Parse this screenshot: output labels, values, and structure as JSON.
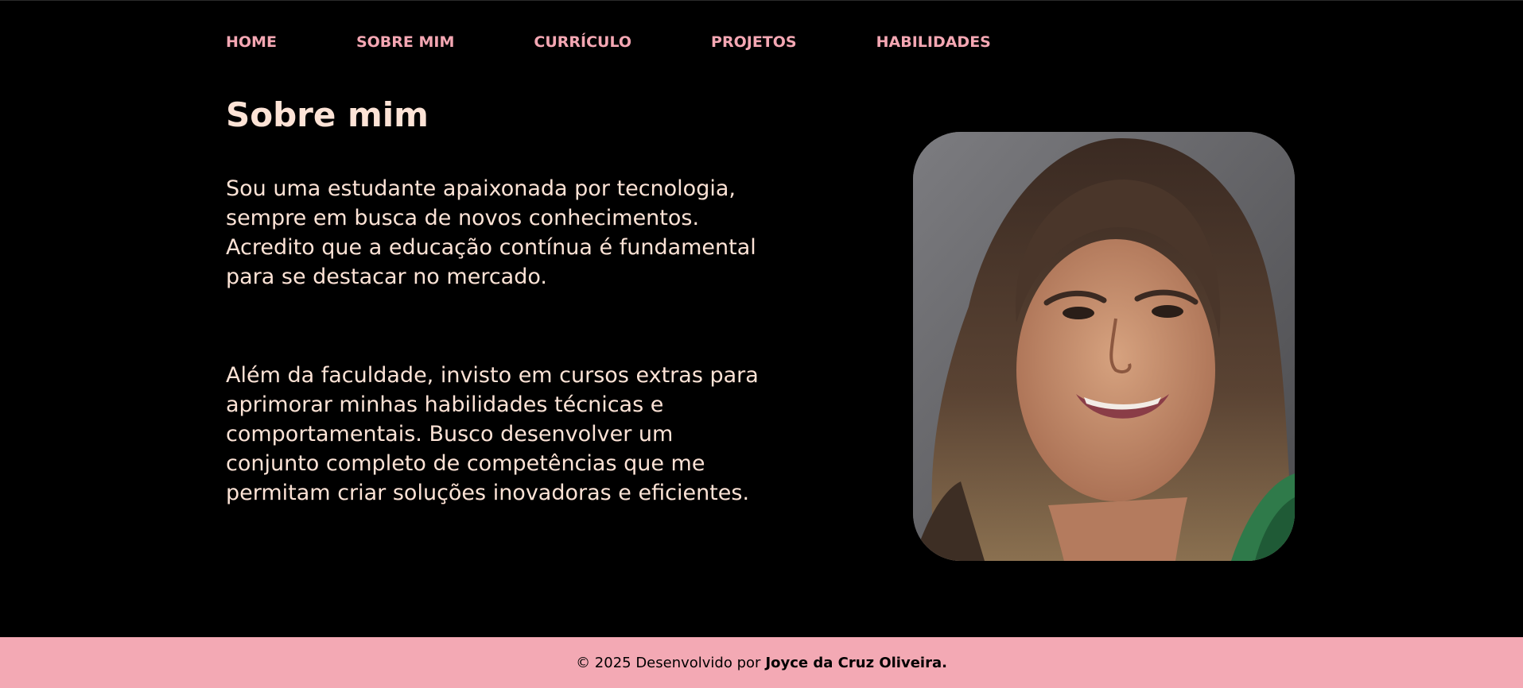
{
  "nav": {
    "items": [
      {
        "label": "HOME"
      },
      {
        "label": "SOBRE MIM"
      },
      {
        "label": "CURRÍCULO"
      },
      {
        "label": "PROJETOS"
      },
      {
        "label": "HABILIDADES"
      }
    ]
  },
  "about": {
    "title": "Sobre mim",
    "paragraph1": "Sou uma estudante apaixonada por tecnologia, sempre em busca de novos conhecimentos. Acredito que a educação contínua é fundamental para se destacar no mercado.",
    "paragraph2": "Além da faculdade, invisto em cursos extras para aprimorar minhas habilidades técnicas e comportamentais. Busco desenvolver um conjunto completo de competências que me permitam criar soluções inovadoras e eficientes."
  },
  "footer": {
    "text": "© 2025 Desenvolvido por",
    "author": "Joyce da Cruz Oliveira."
  },
  "colors": {
    "background": "#000000",
    "nav_link": "#f4a7b3",
    "text": "#fde3d6",
    "footer_background": "#f3a9b4"
  },
  "icons": {
    "profile_photo": "portrait-photo"
  }
}
